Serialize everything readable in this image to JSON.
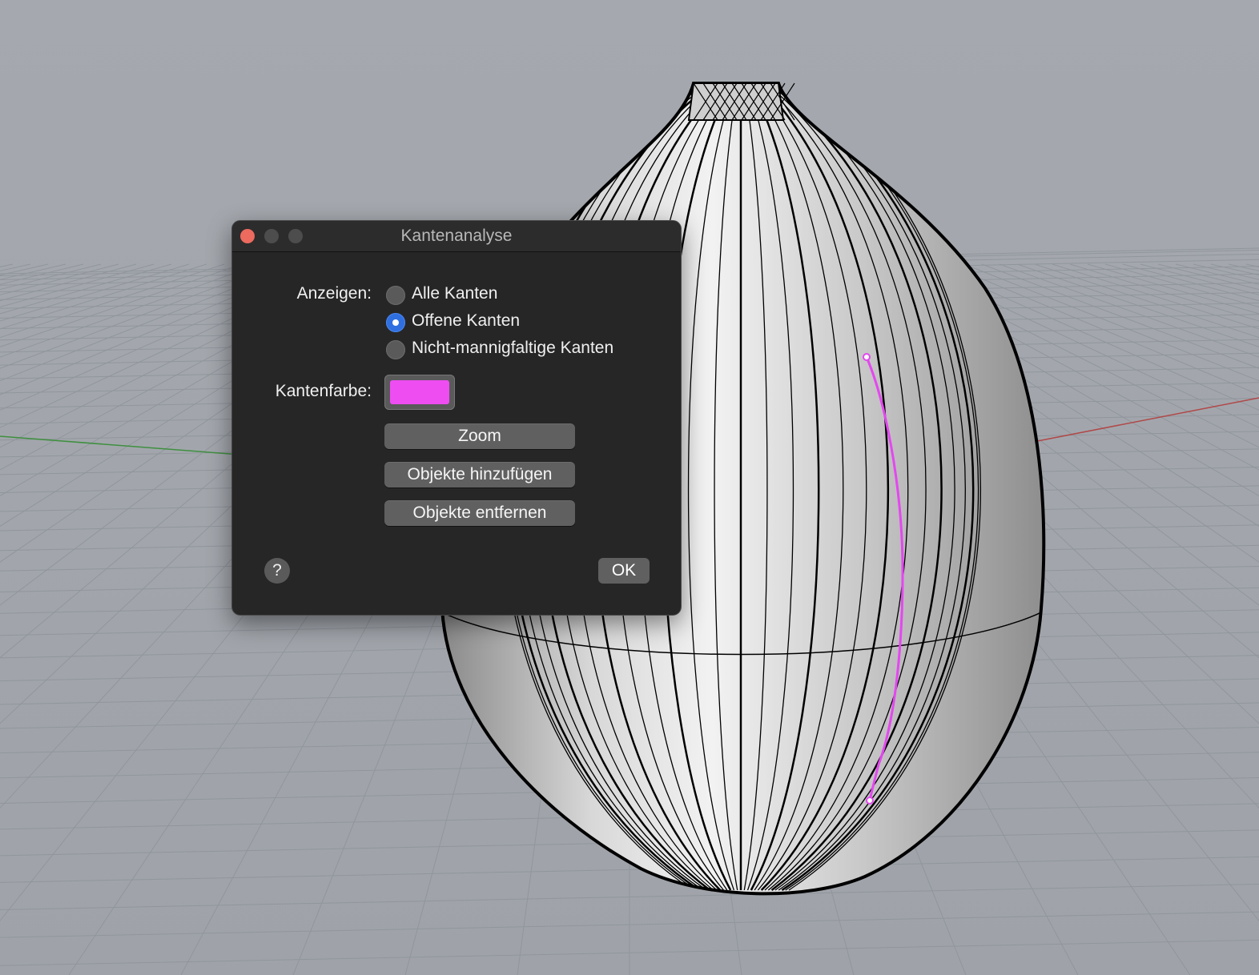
{
  "dialog": {
    "title": "Kantenanalyse",
    "show_label": "Anzeigen:",
    "options": [
      {
        "label": "Alle Kanten",
        "selected": false
      },
      {
        "label": "Offene Kanten",
        "selected": true
      },
      {
        "label": "Nicht-mannigfaltige Kanten",
        "selected": false
      }
    ],
    "edge_color_label": "Kantenfarbe:",
    "edge_color": "#ee4df2",
    "zoom_label": "Zoom",
    "add_objects_label": "Objekte hinzufügen",
    "remove_objects_label": "Objekte entfernen",
    "help_label": "?",
    "ok_label": "OK"
  },
  "colors": {
    "background": "#a3a7ad",
    "grid_line": "#8f949b",
    "x_axis": "#b04848",
    "y_axis": "#3f8f3f",
    "highlight_edge": "#e447f0"
  },
  "icons": {
    "close": "close-icon",
    "minimize": "minimize-icon",
    "zoom_window": "zoom-window-icon",
    "help": "help-icon"
  }
}
